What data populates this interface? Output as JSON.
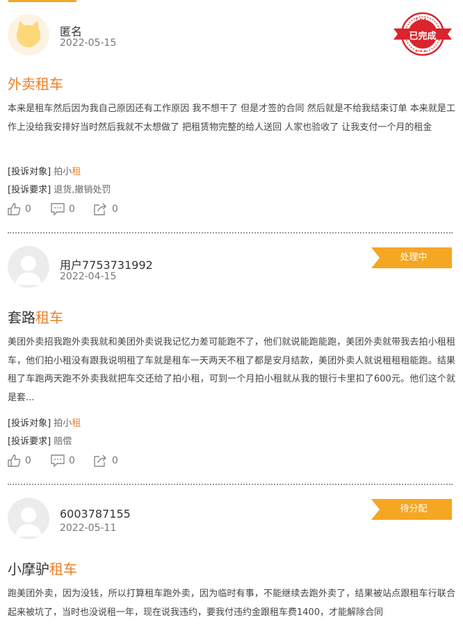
{
  "complaints": [
    {
      "user": "匿名",
      "date": "2022-05-15",
      "status": "已完成",
      "title_prefix": "外卖",
      "title_highlight": "租车",
      "body": "本来是租车然后因为我自己原因还有工作原因 我不想干了 但是才签的合同 然后就是不给我结束订单 本来就是工作上没给我安排好当时然后我就不太想做了 把租赁物完整的给人送回 人家也验收了 让我支付一个月的租金",
      "target_label": "[投诉对象]",
      "target_prefix": "拍小",
      "target_highlight": "租",
      "demand_label": "[投诉要求]",
      "demand": "退货,撤销处罚",
      "likes": "0",
      "comments": "0",
      "shares": "0"
    },
    {
      "user": "用户7753731992",
      "date": "2022-04-15",
      "status": "处理中",
      "title_prefix": "套路",
      "title_highlight": "租车",
      "body": "美团外卖招我跑外卖我就和美团外卖说我记忆力差可能跑不了，他们就说能跑能跑，美团外卖就带我去拍小租租车，他们拍小租没有跟我说明租了车就是租车一天两天不租了都是安月结款，美团外卖人就说租租租能跑。结果租了车跑两天跑不外卖我就把车交还给了拍小租，可到一个月拍小租就从我的银行卡里扣了600元。他们这个就是套...",
      "target_label": "[投诉对象]",
      "target_prefix": "拍小",
      "target_highlight": "租",
      "demand_label": "[投诉要求]",
      "demand": "赔偿",
      "likes": "0",
      "comments": "0",
      "shares": "0"
    },
    {
      "user": "6003787155",
      "date": "2022-05-11",
      "status": "待分配",
      "title_prefix": "小摩驴",
      "title_highlight": "租车",
      "body": "跑美团外卖，因为没钱，所以打算租车跑外卖，因为临时有事，不能继续去跑外卖了，结果被站点跟租车行联合起来被坑了，当时也没说租一年，现在说我违约，要我付违约金跟租车费1400，才能解除合同"
    }
  ],
  "colors": {
    "accent": "#f5a623",
    "highlight": "#e8812b",
    "stamp": "#d9252b"
  },
  "icons": [
    "thumbs-up-icon",
    "comment-icon",
    "share-icon",
    "cat-avatar-icon",
    "user-avatar-icon",
    "completed-stamp-icon"
  ]
}
